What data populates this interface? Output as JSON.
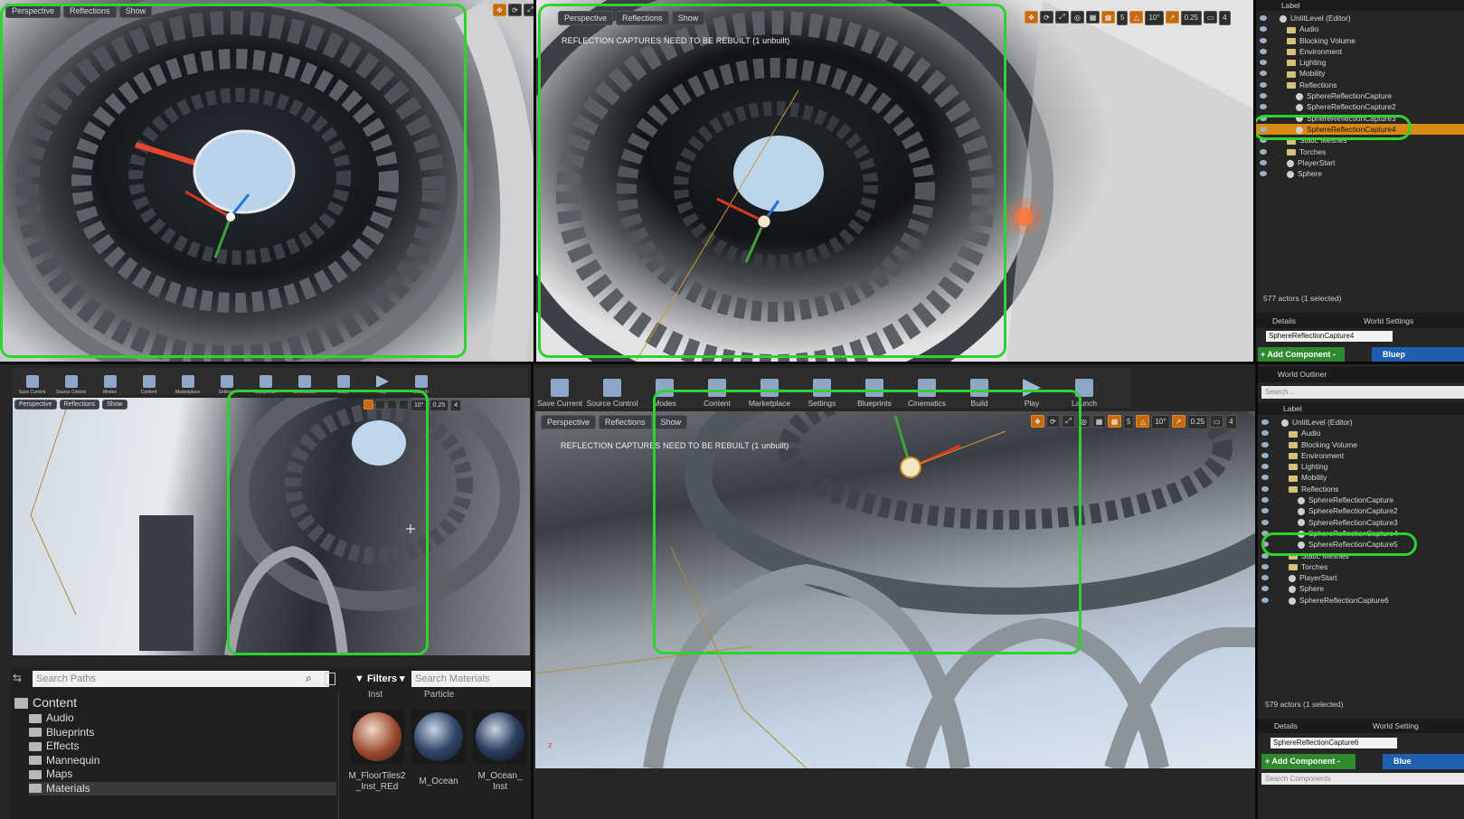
{
  "viewport_tl": {
    "perspective": "Perspective",
    "reflections": "Reflections",
    "show": "Show"
  },
  "viewport_tr": {
    "perspective": "Perspective",
    "reflections": "Reflections",
    "show": "Show",
    "warning": "REFLECTION CAPTURES NEED TO BE REBUILT (1 unbuilt)",
    "grid": "10°",
    "snap": "0.25",
    "cams": "4",
    "five": "5"
  },
  "outliner_top": {
    "header": "Label",
    "items": [
      "UnlitLevel (Editor)",
      "Audio",
      "Blocking Volume",
      "Environment",
      "Lighting",
      "Mobility",
      "Reflections",
      "SphereReflectionCapture",
      "SphereReflectionCapture2",
      "SphereReflectionCapture3",
      "SphereReflectionCapture4",
      "Static Meshes",
      "Torches",
      "PlayerStart",
      "Sphere"
    ],
    "count": "577 actors (1 selected)",
    "details_tab": "Details",
    "world_tab": "World Settings",
    "name_value": "SphereReflectionCapture4",
    "add_component": "+ Add Component -",
    "blueprint": "Bluep"
  },
  "toolbar_bl": [
    "Save Current",
    "Source Control",
    "Modes",
    "Content",
    "Marketplace",
    "Settings",
    "Blueprints",
    "Cinematics",
    "Build",
    "Play",
    "Launch"
  ],
  "viewport_bl": {
    "perspective": "Perspective",
    "reflections": "Reflections",
    "show": "Show",
    "grid": "10°",
    "snap": "0.25",
    "cams": "4"
  },
  "content_browser": {
    "search_paths": "Search Paths",
    "filters": "Filters",
    "search_materials": "Search Materials",
    "root": "Content",
    "folders": [
      "Audio",
      "Blueprints",
      "Effects",
      "Mannequin",
      "Maps",
      "Materials"
    ],
    "top_labels": [
      "Inst",
      "Particle"
    ],
    "assets": [
      "M_FloorTiles2 _Inst_REd",
      "M_Ocean",
      "M_Ocean_ Inst"
    ]
  },
  "toolbar_br": [
    "Save Current",
    "Source Control",
    "Modes",
    "Content",
    "Marketplace",
    "Settings",
    "Blueprints",
    "Cinematics",
    "Build",
    "Play",
    "Launch"
  ],
  "viewport_br": {
    "perspective": "Perspective",
    "reflections": "Reflections",
    "show": "Show",
    "warning": "REFLECTION CAPTURES NEED TO BE REBUILT (1 unbuilt)",
    "grid": "10°",
    "snap": "0.25",
    "cams": "4",
    "five": "5"
  },
  "outliner_br": {
    "title": "World Outliner",
    "search": "Search...",
    "header": "Label",
    "items": [
      "UnlitLevel (Editor)",
      "Audio",
      "Blocking Volume",
      "Environment",
      "Lighting",
      "Mobility",
      "Reflections",
      "SphereReflectionCapture",
      "SphereReflectionCapture2",
      "SphereReflectionCapture3",
      "SphereReflectionCapture4",
      "SphereReflectionCapture5",
      "Static Meshes",
      "Torches",
      "PlayerStart",
      "Sphere",
      "SphereReflectionCapture6"
    ],
    "count": "579 actors (1 selected)",
    "details_tab": "Details",
    "world_tab": "World Setting",
    "name_value": "SphereReflectionCapture6",
    "add_component": "+ Add Component -",
    "blueprint": "Blue",
    "search_components": "Search Components"
  },
  "colors": {
    "highlight": "#2fd32f",
    "selection": "#d88a12",
    "panel": "#262626"
  }
}
